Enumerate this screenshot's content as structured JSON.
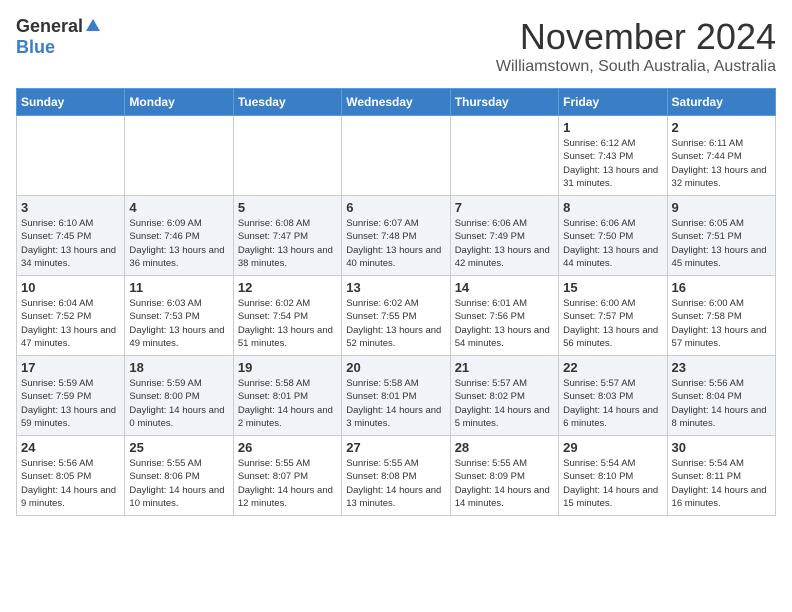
{
  "header": {
    "logo_general": "General",
    "logo_blue": "Blue",
    "month": "November 2024",
    "location": "Williamstown, South Australia, Australia"
  },
  "days_of_week": [
    "Sunday",
    "Monday",
    "Tuesday",
    "Wednesday",
    "Thursday",
    "Friday",
    "Saturday"
  ],
  "weeks": [
    [
      {
        "day": "",
        "info": ""
      },
      {
        "day": "",
        "info": ""
      },
      {
        "day": "",
        "info": ""
      },
      {
        "day": "",
        "info": ""
      },
      {
        "day": "",
        "info": ""
      },
      {
        "day": "1",
        "info": "Sunrise: 6:12 AM\nSunset: 7:43 PM\nDaylight: 13 hours and 31 minutes."
      },
      {
        "day": "2",
        "info": "Sunrise: 6:11 AM\nSunset: 7:44 PM\nDaylight: 13 hours and 32 minutes."
      }
    ],
    [
      {
        "day": "3",
        "info": "Sunrise: 6:10 AM\nSunset: 7:45 PM\nDaylight: 13 hours and 34 minutes."
      },
      {
        "day": "4",
        "info": "Sunrise: 6:09 AM\nSunset: 7:46 PM\nDaylight: 13 hours and 36 minutes."
      },
      {
        "day": "5",
        "info": "Sunrise: 6:08 AM\nSunset: 7:47 PM\nDaylight: 13 hours and 38 minutes."
      },
      {
        "day": "6",
        "info": "Sunrise: 6:07 AM\nSunset: 7:48 PM\nDaylight: 13 hours and 40 minutes."
      },
      {
        "day": "7",
        "info": "Sunrise: 6:06 AM\nSunset: 7:49 PM\nDaylight: 13 hours and 42 minutes."
      },
      {
        "day": "8",
        "info": "Sunrise: 6:06 AM\nSunset: 7:50 PM\nDaylight: 13 hours and 44 minutes."
      },
      {
        "day": "9",
        "info": "Sunrise: 6:05 AM\nSunset: 7:51 PM\nDaylight: 13 hours and 45 minutes."
      }
    ],
    [
      {
        "day": "10",
        "info": "Sunrise: 6:04 AM\nSunset: 7:52 PM\nDaylight: 13 hours and 47 minutes."
      },
      {
        "day": "11",
        "info": "Sunrise: 6:03 AM\nSunset: 7:53 PM\nDaylight: 13 hours and 49 minutes."
      },
      {
        "day": "12",
        "info": "Sunrise: 6:02 AM\nSunset: 7:54 PM\nDaylight: 13 hours and 51 minutes."
      },
      {
        "day": "13",
        "info": "Sunrise: 6:02 AM\nSunset: 7:55 PM\nDaylight: 13 hours and 52 minutes."
      },
      {
        "day": "14",
        "info": "Sunrise: 6:01 AM\nSunset: 7:56 PM\nDaylight: 13 hours and 54 minutes."
      },
      {
        "day": "15",
        "info": "Sunrise: 6:00 AM\nSunset: 7:57 PM\nDaylight: 13 hours and 56 minutes."
      },
      {
        "day": "16",
        "info": "Sunrise: 6:00 AM\nSunset: 7:58 PM\nDaylight: 13 hours and 57 minutes."
      }
    ],
    [
      {
        "day": "17",
        "info": "Sunrise: 5:59 AM\nSunset: 7:59 PM\nDaylight: 13 hours and 59 minutes."
      },
      {
        "day": "18",
        "info": "Sunrise: 5:59 AM\nSunset: 8:00 PM\nDaylight: 14 hours and 0 minutes."
      },
      {
        "day": "19",
        "info": "Sunrise: 5:58 AM\nSunset: 8:01 PM\nDaylight: 14 hours and 2 minutes."
      },
      {
        "day": "20",
        "info": "Sunrise: 5:58 AM\nSunset: 8:01 PM\nDaylight: 14 hours and 3 minutes."
      },
      {
        "day": "21",
        "info": "Sunrise: 5:57 AM\nSunset: 8:02 PM\nDaylight: 14 hours and 5 minutes."
      },
      {
        "day": "22",
        "info": "Sunrise: 5:57 AM\nSunset: 8:03 PM\nDaylight: 14 hours and 6 minutes."
      },
      {
        "day": "23",
        "info": "Sunrise: 5:56 AM\nSunset: 8:04 PM\nDaylight: 14 hours and 8 minutes."
      }
    ],
    [
      {
        "day": "24",
        "info": "Sunrise: 5:56 AM\nSunset: 8:05 PM\nDaylight: 14 hours and 9 minutes."
      },
      {
        "day": "25",
        "info": "Sunrise: 5:55 AM\nSunset: 8:06 PM\nDaylight: 14 hours and 10 minutes."
      },
      {
        "day": "26",
        "info": "Sunrise: 5:55 AM\nSunset: 8:07 PM\nDaylight: 14 hours and 12 minutes."
      },
      {
        "day": "27",
        "info": "Sunrise: 5:55 AM\nSunset: 8:08 PM\nDaylight: 14 hours and 13 minutes."
      },
      {
        "day": "28",
        "info": "Sunrise: 5:55 AM\nSunset: 8:09 PM\nDaylight: 14 hours and 14 minutes."
      },
      {
        "day": "29",
        "info": "Sunrise: 5:54 AM\nSunset: 8:10 PM\nDaylight: 14 hours and 15 minutes."
      },
      {
        "day": "30",
        "info": "Sunrise: 5:54 AM\nSunset: 8:11 PM\nDaylight: 14 hours and 16 minutes."
      }
    ]
  ]
}
